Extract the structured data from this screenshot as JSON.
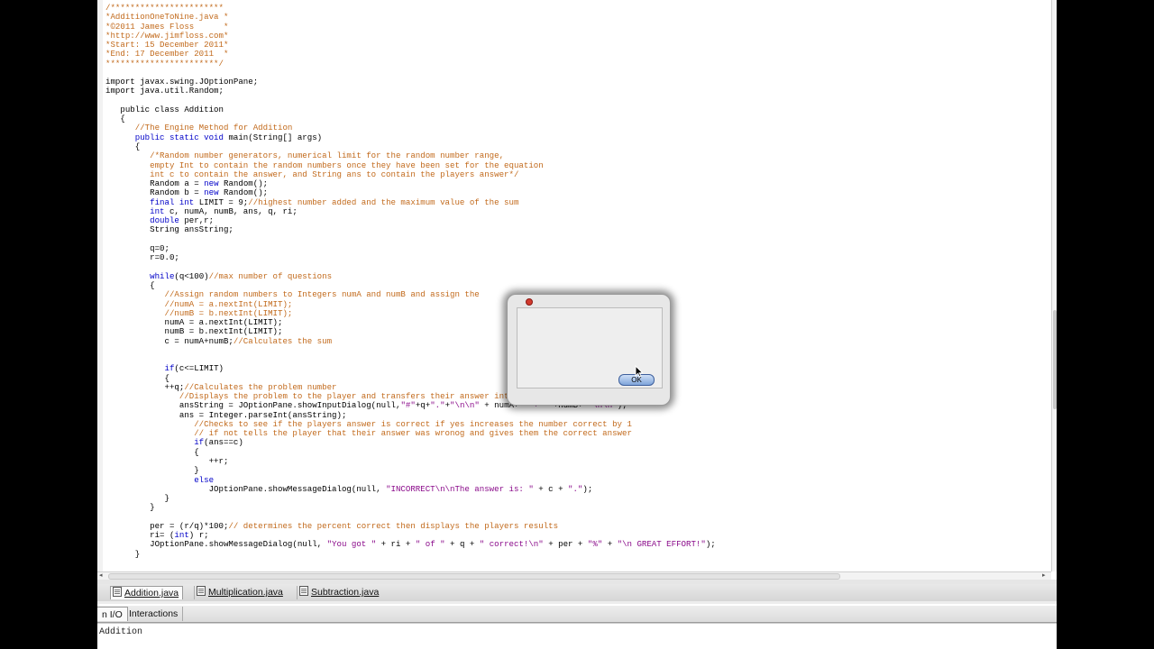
{
  "editor": {
    "lines": [
      [
        {
          "t": "/***********************",
          "c": "comment"
        }
      ],
      [
        {
          "t": "*AdditionOneToNine.java *",
          "c": "comment"
        }
      ],
      [
        {
          "t": "*©2011 James Floss      *",
          "c": "comment"
        }
      ],
      [
        {
          "t": "*http://www.jimfloss.com*",
          "c": "comment"
        }
      ],
      [
        {
          "t": "*Start: 15 December 2011*",
          "c": "comment"
        }
      ],
      [
        {
          "t": "*End: 17 December 2011  *",
          "c": "comment"
        }
      ],
      [
        {
          "t": "***********************/",
          "c": "comment"
        }
      ],
      [],
      [
        {
          "t": "import ",
          "c": "plain"
        },
        {
          "t": "javax.swing.JOptionPane;",
          "c": "plain"
        }
      ],
      [
        {
          "t": "import ",
          "c": "plain"
        },
        {
          "t": "java.util.Random;",
          "c": "plain"
        }
      ],
      [],
      [
        {
          "t": "   public class Addition",
          "c": "plain"
        }
      ],
      [
        {
          "t": "   {",
          "c": "plain"
        }
      ],
      [
        {
          "t": "      //The Engine Method for Addition",
          "c": "comment"
        }
      ],
      [
        {
          "t": "      public static void ",
          "c": "keyword"
        },
        {
          "t": "main(String[] args)",
          "c": "plain"
        }
      ],
      [
        {
          "t": "      {",
          "c": "plain"
        }
      ],
      [
        {
          "t": "         /*Random number generators, numerical limit for the random number range,",
          "c": "comment"
        }
      ],
      [
        {
          "t": "         empty Int to contain the random numbers once they have been set for the equation",
          "c": "comment"
        }
      ],
      [
        {
          "t": "         int c to contain the answer, and String ans to contain the players answer*/",
          "c": "comment"
        }
      ],
      [
        {
          "t": "         Random a = ",
          "c": "plain"
        },
        {
          "t": "new ",
          "c": "keyword"
        },
        {
          "t": "Random();",
          "c": "plain"
        }
      ],
      [
        {
          "t": "         Random b = ",
          "c": "plain"
        },
        {
          "t": "new ",
          "c": "keyword"
        },
        {
          "t": "Random();",
          "c": "plain"
        }
      ],
      [
        {
          "t": "         final int ",
          "c": "keyword"
        },
        {
          "t": "LIMIT = 9;",
          "c": "plain"
        },
        {
          "t": "//highest number added and the maximum value of the sum",
          "c": "comment"
        }
      ],
      [
        {
          "t": "         int ",
          "c": "keyword"
        },
        {
          "t": "c, numA, numB, ans, q, ri;",
          "c": "plain"
        }
      ],
      [
        {
          "t": "         double ",
          "c": "keyword"
        },
        {
          "t": "per,r;",
          "c": "plain"
        }
      ],
      [
        {
          "t": "         String ansString;",
          "c": "plain"
        }
      ],
      [],
      [
        {
          "t": "         q=0;",
          "c": "plain"
        }
      ],
      [
        {
          "t": "         r=0.0;",
          "c": "plain"
        }
      ],
      [],
      [
        {
          "t": "         while",
          "c": "keyword"
        },
        {
          "t": "(q<100)",
          "c": "plain"
        },
        {
          "t": "//max number of questions",
          "c": "comment"
        }
      ],
      [
        {
          "t": "         {",
          "c": "plain"
        }
      ],
      [
        {
          "t": "            //Assign random numbers to Integers numA and numB and assign the",
          "c": "comment"
        }
      ],
      [
        {
          "t": "            //numA = a.nextInt(LIMIT);",
          "c": "comment"
        }
      ],
      [
        {
          "t": "            //numB = b.nextInt(LIMIT);",
          "c": "comment"
        }
      ],
      [
        {
          "t": "            numA = a.nextInt(LIMIT);",
          "c": "plain"
        }
      ],
      [
        {
          "t": "            numB = b.nextInt(LIMIT);",
          "c": "plain"
        }
      ],
      [
        {
          "t": "            c = numA+numB;",
          "c": "plain"
        },
        {
          "t": "//Calculates the sum",
          "c": "comment"
        }
      ],
      [],
      [],
      [
        {
          "t": "            if",
          "c": "keyword"
        },
        {
          "t": "(c<=LIMIT)",
          "c": "plain"
        }
      ],
      [
        {
          "t": "            {",
          "c": "plain"
        }
      ],
      [
        {
          "t": "            ++q;",
          "c": "plain"
        },
        {
          "t": "//Calculates the problem number",
          "c": "comment"
        }
      ],
      [
        {
          "t": "               //Displays the problem to the player and transfers their answer into an Integer",
          "c": "comment"
        }
      ],
      [
        {
          "t": "               ansString = JOptionPane.showInputDialog(null,",
          "c": "plain"
        },
        {
          "t": "\"#\"",
          "c": "string"
        },
        {
          "t": "+q+",
          "c": "plain"
        },
        {
          "t": "\".\"",
          "c": "string"
        },
        {
          "t": "+",
          "c": "plain"
        },
        {
          "t": "\"\\n\\n\"",
          "c": "string"
        },
        {
          "t": " + numA+ ",
          "c": "plain"
        },
        {
          "t": "\" + \"",
          "c": "string"
        },
        {
          "t": " +numB+ ",
          "c": "plain"
        },
        {
          "t": "\"\\n\\n\"",
          "c": "string"
        },
        {
          "t": ");",
          "c": "plain"
        }
      ],
      [
        {
          "t": "               ans = Integer.parseInt(ansString);",
          "c": "plain"
        }
      ],
      [
        {
          "t": "                  //Checks to see if the players answer is correct if yes increases the number correct by 1",
          "c": "comment"
        }
      ],
      [
        {
          "t": "                  // if not tells the player that their answer was wronog and gives them the correct answer",
          "c": "comment"
        }
      ],
      [
        {
          "t": "                  if",
          "c": "keyword"
        },
        {
          "t": "(ans==c)",
          "c": "plain"
        }
      ],
      [
        {
          "t": "                  {",
          "c": "plain"
        }
      ],
      [
        {
          "t": "                     ++r;",
          "c": "plain"
        }
      ],
      [
        {
          "t": "                  }",
          "c": "plain"
        }
      ],
      [
        {
          "t": "                  else",
          "c": "keyword"
        }
      ],
      [
        {
          "t": "                     JOptionPane.showMessageDialog(null, ",
          "c": "plain"
        },
        {
          "t": "\"INCORRECT\\n\\nThe answer is: \"",
          "c": "string"
        },
        {
          "t": " + c + ",
          "c": "plain"
        },
        {
          "t": "\".\"",
          "c": "string"
        },
        {
          "t": ");",
          "c": "plain"
        }
      ],
      [
        {
          "t": "            }",
          "c": "plain"
        }
      ],
      [
        {
          "t": "         }",
          "c": "plain"
        }
      ],
      [],
      [
        {
          "t": "         per = (r/q)*100;",
          "c": "plain"
        },
        {
          "t": "// determines the percent correct then displays the players results",
          "c": "comment"
        }
      ],
      [
        {
          "t": "         ri= (",
          "c": "plain"
        },
        {
          "t": "int",
          "c": "keyword"
        },
        {
          "t": ") r;",
          "c": "plain"
        }
      ],
      [
        {
          "t": "         JOptionPane.showMessageDialog(null, ",
          "c": "plain"
        },
        {
          "t": "\"You got \"",
          "c": "string"
        },
        {
          "t": " + ri + ",
          "c": "plain"
        },
        {
          "t": "\" of \"",
          "c": "string"
        },
        {
          "t": " + q + ",
          "c": "plain"
        },
        {
          "t": "\" correct!\\n\"",
          "c": "string"
        },
        {
          "t": " + per + ",
          "c": "plain"
        },
        {
          "t": "\"%\"",
          "c": "string"
        },
        {
          "t": " + ",
          "c": "plain"
        },
        {
          "t": "\"\\n GREAT EFFORT!\"",
          "c": "string"
        },
        {
          "t": ");",
          "c": "plain"
        }
      ],
      [
        {
          "t": "      }",
          "c": "plain"
        }
      ]
    ]
  },
  "colors": {
    "comment": "#c26a1c",
    "keyword": "#0000c8",
    "string": "#8a0a8a",
    "ok_button": "#7fa5da"
  },
  "document_tabs": [
    {
      "label": "Addition.java",
      "active": true,
      "icon": "java-file-icon"
    },
    {
      "label": "Multiplication.java",
      "active": false,
      "icon": "java-file-icon"
    },
    {
      "label": "Subtraction.java",
      "active": false,
      "icon": "java-file-icon"
    }
  ],
  "console_tabs": [
    {
      "label": "n I/O",
      "active": true
    },
    {
      "label": "Interactions",
      "active": false
    }
  ],
  "console": {
    "output": "Addition"
  },
  "dialog": {
    "ok_label": "OK",
    "close_icon": "close-icon",
    "cursor_icon": "arrow-cursor-icon"
  }
}
